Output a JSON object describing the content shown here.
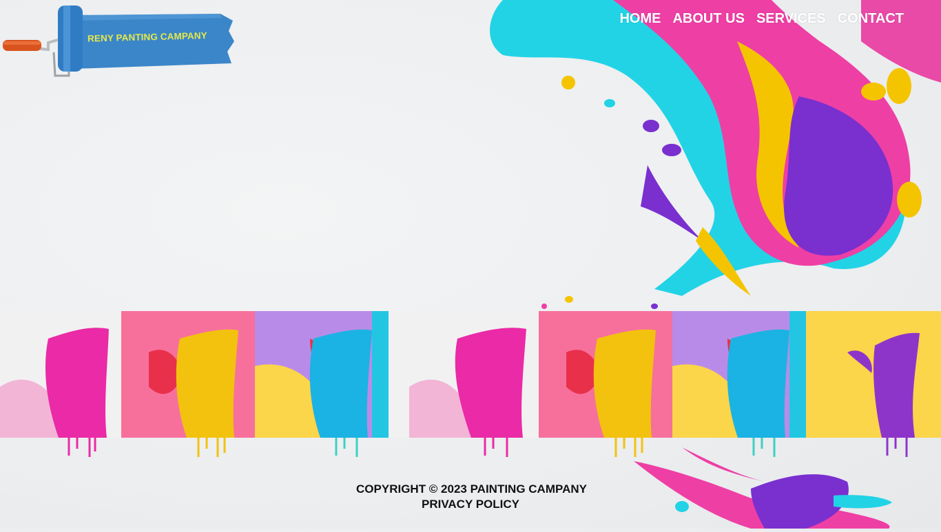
{
  "brand": {
    "name": "RENY PANTING CAMPANY",
    "logo_icon": "paint-roller-icon",
    "banner_color": "#3b86c9",
    "text_color": "#e6e84a"
  },
  "nav": {
    "items": [
      {
        "label": "HOME"
      },
      {
        "label": "ABOUT US"
      },
      {
        "label": "SERVICES"
      },
      {
        "label": "CONTACT"
      }
    ]
  },
  "decor": {
    "hero_splash": "paint-splash-image",
    "colors": [
      "#22d3e6",
      "#ee3fa5",
      "#f5c400",
      "#7a2fcf"
    ]
  },
  "gallery": {
    "tiles": [
      {
        "name": "pink-paint-stroke",
        "bg": "#f1f1f1",
        "paint": "#ea2aa6"
      },
      {
        "name": "yellow-paint-stroke",
        "bg": "#f7709c",
        "paint": "#f2c20f"
      },
      {
        "name": "blue-paint-stroke",
        "bg": "#b98be8",
        "paint": "#1bb3e3"
      },
      {
        "name": "pink-paint-stroke",
        "bg": "#f1f1f1",
        "paint": "#ea2aa6"
      },
      {
        "name": "yellow-paint-stroke",
        "bg": "#f7709c",
        "paint": "#f2c20f"
      },
      {
        "name": "blue-paint-stroke",
        "bg": "#b98be8",
        "paint": "#1bb3e3"
      },
      {
        "name": "purple-paint-stroke",
        "bg": "#fbd54a",
        "paint": "#8e35c9"
      }
    ]
  },
  "footer": {
    "copyright": "COPYRIGHT © 2023  PAINTING CAMPANY",
    "privacy": "PRIVACY POLICY"
  }
}
